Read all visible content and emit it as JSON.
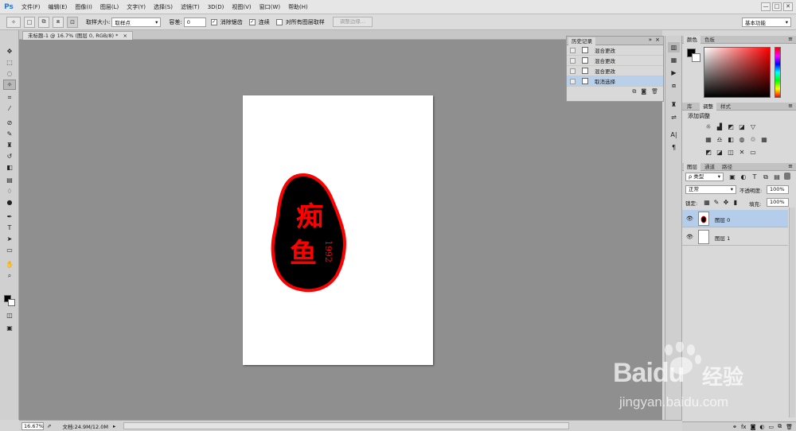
{
  "app": {
    "logo": "Ps",
    "menu": [
      "文件(F)",
      "编辑(E)",
      "图像(I)",
      "图层(L)",
      "文字(Y)",
      "选择(S)",
      "滤镜(T)",
      "3D(D)",
      "视图(V)",
      "窗口(W)",
      "帮助(H)"
    ],
    "window_controls": [
      "—",
      "□",
      "✕"
    ]
  },
  "options": {
    "sample_size_label": "取样大小:",
    "sample_size_value": "取样点",
    "tolerance_label": "容差:",
    "tolerance_value": "0",
    "antialias_label": "消除锯齿",
    "contiguous_label": "连续",
    "all_layers_label": "对所有图层取样",
    "refine_edge_label": "调整边缘...",
    "workspace_value": "基本功能"
  },
  "document": {
    "tab_title": "未标题-1 @ 16.7% (图层 0, RGB/8) *",
    "zoom": "16.67%",
    "doc_size": "文档:24.9M/12.0M"
  },
  "artwork": {
    "char1": "痴",
    "char2": "鱼",
    "year": "1992",
    "ink_color": "#ff0000",
    "bg_color": "#000000"
  },
  "history": {
    "title": "历史记录",
    "items": [
      {
        "label": "混合更改"
      },
      {
        "label": "混合更改"
      },
      {
        "label": "混合更改"
      },
      {
        "label": "取消选择"
      }
    ]
  },
  "color_panel": {
    "tabs": [
      "颜色",
      "色板"
    ]
  },
  "adjust_panel": {
    "tabs": [
      "库",
      "调整",
      "样式"
    ],
    "title": "添加调整"
  },
  "layers_panel": {
    "tabs": [
      "图层",
      "通道",
      "路径"
    ],
    "kind_filter": "ρ 类型",
    "blend_mode": "正常",
    "opacity_label": "不透明度:",
    "opacity_value": "100%",
    "lock_label": "锁定:",
    "fill_label": "填充:",
    "fill_value": "100%",
    "layers": [
      {
        "name": "图层 0",
        "selected": true
      },
      {
        "name": "图层 1",
        "selected": false
      }
    ]
  },
  "watermark": {
    "brand": "Baidu",
    "brand_cn": "经验",
    "url": "jingyan.baidu.com"
  }
}
